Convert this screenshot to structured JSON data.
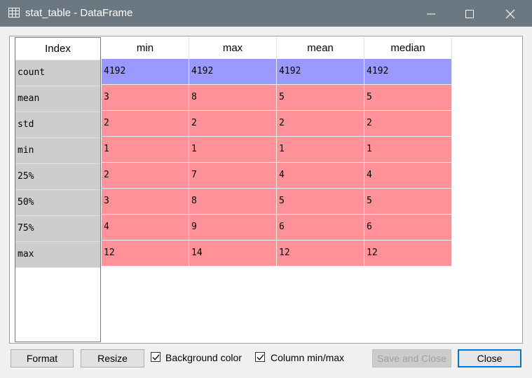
{
  "window": {
    "title": "stat_table - DataFrame",
    "icon": "table-icon"
  },
  "table": {
    "index_header": "Index",
    "columns": [
      "min",
      "max",
      "mean",
      "median"
    ],
    "rows": [
      {
        "label": "count",
        "values": [
          "4192",
          "4192",
          "4192",
          "4192"
        ],
        "bg": "#9999ff"
      },
      {
        "label": "mean",
        "values": [
          "3",
          "8",
          "5",
          "5"
        ],
        "bg": "#ff9198"
      },
      {
        "label": "std",
        "values": [
          "2",
          "2",
          "2",
          "2"
        ],
        "bg": "#ff9198"
      },
      {
        "label": "min",
        "values": [
          "1",
          "1",
          "1",
          "1"
        ],
        "bg": "#ff9198"
      },
      {
        "label": "25%",
        "values": [
          "2",
          "7",
          "4",
          "4"
        ],
        "bg": "#ff9198"
      },
      {
        "label": "50%",
        "values": [
          "3",
          "8",
          "5",
          "5"
        ],
        "bg": "#ff9198"
      },
      {
        "label": "75%",
        "values": [
          "4",
          "9",
          "6",
          "6"
        ],
        "bg": "#ff9198"
      },
      {
        "label": "max",
        "values": [
          "12",
          "14",
          "12",
          "12"
        ],
        "bg": "#ff9198"
      }
    ]
  },
  "toolbar": {
    "format_label": "Format",
    "resize_label": "Resize",
    "bg_color_label": "Background color",
    "bg_color_checked": true,
    "col_minmax_label": "Column min/max",
    "col_minmax_checked": true,
    "save_close_label": "Save and Close",
    "close_label": "Close"
  }
}
